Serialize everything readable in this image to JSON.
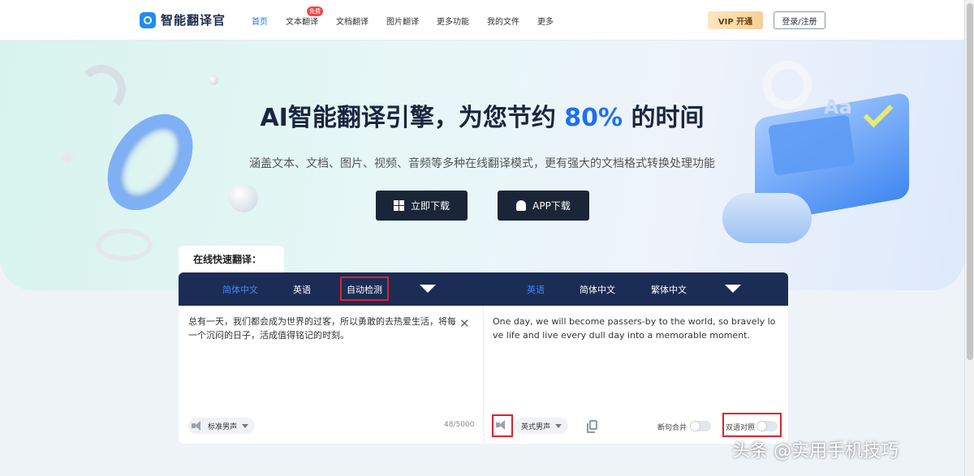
{
  "header": {
    "brand": "智能翻译官",
    "nav": [
      {
        "label": "首页",
        "active": true
      },
      {
        "label": "文本翻译",
        "badge": "免费"
      },
      {
        "label": "文档翻译"
      },
      {
        "label": "图片翻译"
      },
      {
        "label": "更多功能"
      },
      {
        "label": "我的文件"
      },
      {
        "label": "更多"
      }
    ],
    "vip_label": "VIP 开通",
    "login_label": "登录/注册"
  },
  "hero": {
    "title_pre": "AI智能翻译引擎，为您节约 ",
    "title_accent": "80%",
    "title_post": " 的时间",
    "subtitle": "涵盖文本、文档、图片、视频、音频等多种在线翻译模式，更有强大的文档格式转换处理功能",
    "download_label": "立即下载",
    "app_label": "APP下载",
    "deco_text": "Aa"
  },
  "translator": {
    "section_label": "在线快速翻译：",
    "source_langs": [
      "简体中文",
      "英语",
      "自动检测"
    ],
    "target_langs": [
      "英语",
      "简体中文",
      "繁体中文"
    ],
    "source_text": "总有一天，我们都会成为世界的过客，所以勇敢的去热爱生活，将每一个沉闷的日子，活成值得铭记的时刻。",
    "target_text": "One day, we will become passers-by to the world, so bravely love life and live every dull day into a memorable moment.",
    "source_voice": "标准男声",
    "target_voice": "英式男声",
    "char_count": "48/5000",
    "toggle_merge": "断句合并",
    "toggle_compare": "双语对照",
    "close_glyph": "✕"
  },
  "watermark": "头条 @实用手机技巧",
  "colors": {
    "accent": "#1f6ff0",
    "panel_bar": "#1b2c55",
    "highlight_box": "#e0212c",
    "button_dark": "#1b2538"
  }
}
